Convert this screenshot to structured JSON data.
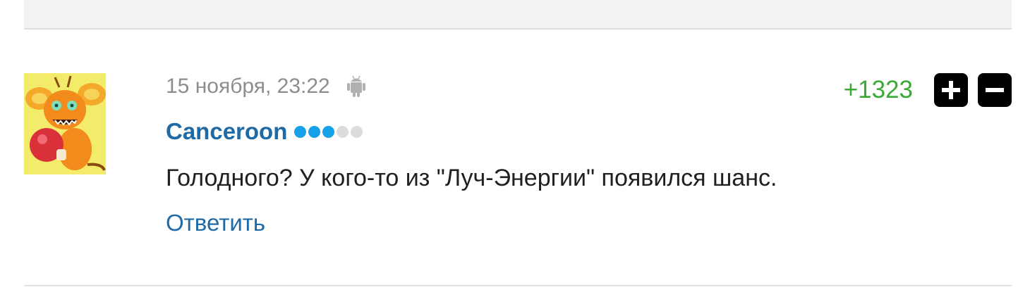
{
  "comment": {
    "date": "15 ноября, 23:22",
    "device_icon": "android-icon",
    "author": "Canceroon",
    "author_rating": {
      "filled": 3,
      "total": 5
    },
    "text": "Голодного? У кого-то из \"Луч-Энергии\" появился шанс.",
    "reply_label": "Ответить",
    "score": "+1323",
    "upvote_icon": "plus-icon",
    "downvote_icon": "minus-icon"
  },
  "colors": {
    "author": "#1f6aa5",
    "score_positive": "#3aaa35",
    "rating_dot_on": "#16a0e8",
    "rating_dot_off": "#dcdcdc",
    "meta_text": "#8d8d8d"
  }
}
